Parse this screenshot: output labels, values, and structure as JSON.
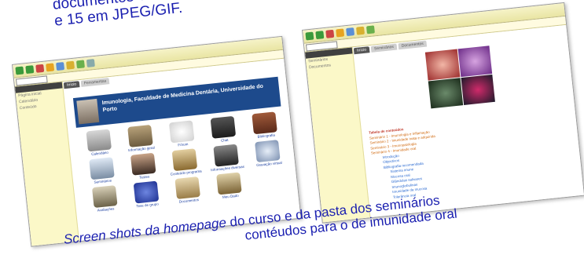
{
  "caption_top": {
    "line1": "documentos em formato PDF,",
    "line2": "e 15 em JPEG/GIF."
  },
  "caption_bottom": {
    "italic_part": "Screen shots da homepage",
    "rest": "do curso e da pasta dos seminários",
    "line2": "contéudos para o de imunidade oral"
  },
  "left_window": {
    "tabs": [
      "Início",
      "Ferramentas"
    ],
    "sidebar_items": [
      "Página inicial",
      "Calendário",
      "Conteúdo"
    ],
    "banner_title": "Imunologia, Faculdade de Medicina Dentária, Universidade do Porto",
    "tools": [
      "Calendário",
      "Informação geral",
      "Fórum",
      "Chat",
      "Bibliografia",
      "Seminários",
      "Testes",
      "Conteúdo programa",
      "Informações diversas",
      "Gravação virtual",
      "Avaliações",
      "Tese de grupo",
      "Documentos",
      "Meu Dado"
    ],
    "colors": {
      "banner": "#1d4a8c",
      "sidebar": "#fbf8c8",
      "toolbar": "#e9e5a3"
    }
  },
  "right_window": {
    "tabs": [
      "Início",
      "Seminários",
      "Documentos"
    ],
    "sidebar_items": [
      "Seminários",
      "Documentos"
    ],
    "tree_title": "Tabela de conteúdos",
    "tree": [
      {
        "level": "l1",
        "text": "Seminário 1 - Imunologia e Inflamação"
      },
      {
        "level": "l1",
        "text": "Seminário 2 - Imunidade inata e adquirida"
      },
      {
        "level": "l1",
        "text": "Seminário 3 - Imunopatologia"
      },
      {
        "level": "l1",
        "text": "Seminário 4 - Imunidade oral"
      },
      {
        "level": "l2",
        "text": "Introdução"
      },
      {
        "level": "l2",
        "text": "Objectivos"
      },
      {
        "level": "l2",
        "text": "Bibliografia recomendada"
      },
      {
        "level": "l3",
        "text": "Sistema imune"
      },
      {
        "level": "l3",
        "text": "Mucosa oral"
      },
      {
        "level": "l3",
        "text": "Glândulas salivares"
      },
      {
        "level": "l3",
        "text": "Imunoglobulinas"
      },
      {
        "level": "l3",
        "text": "Imunidade da mucosa"
      },
      {
        "level": "l3",
        "text": "Tolerância oral"
      }
    ]
  }
}
